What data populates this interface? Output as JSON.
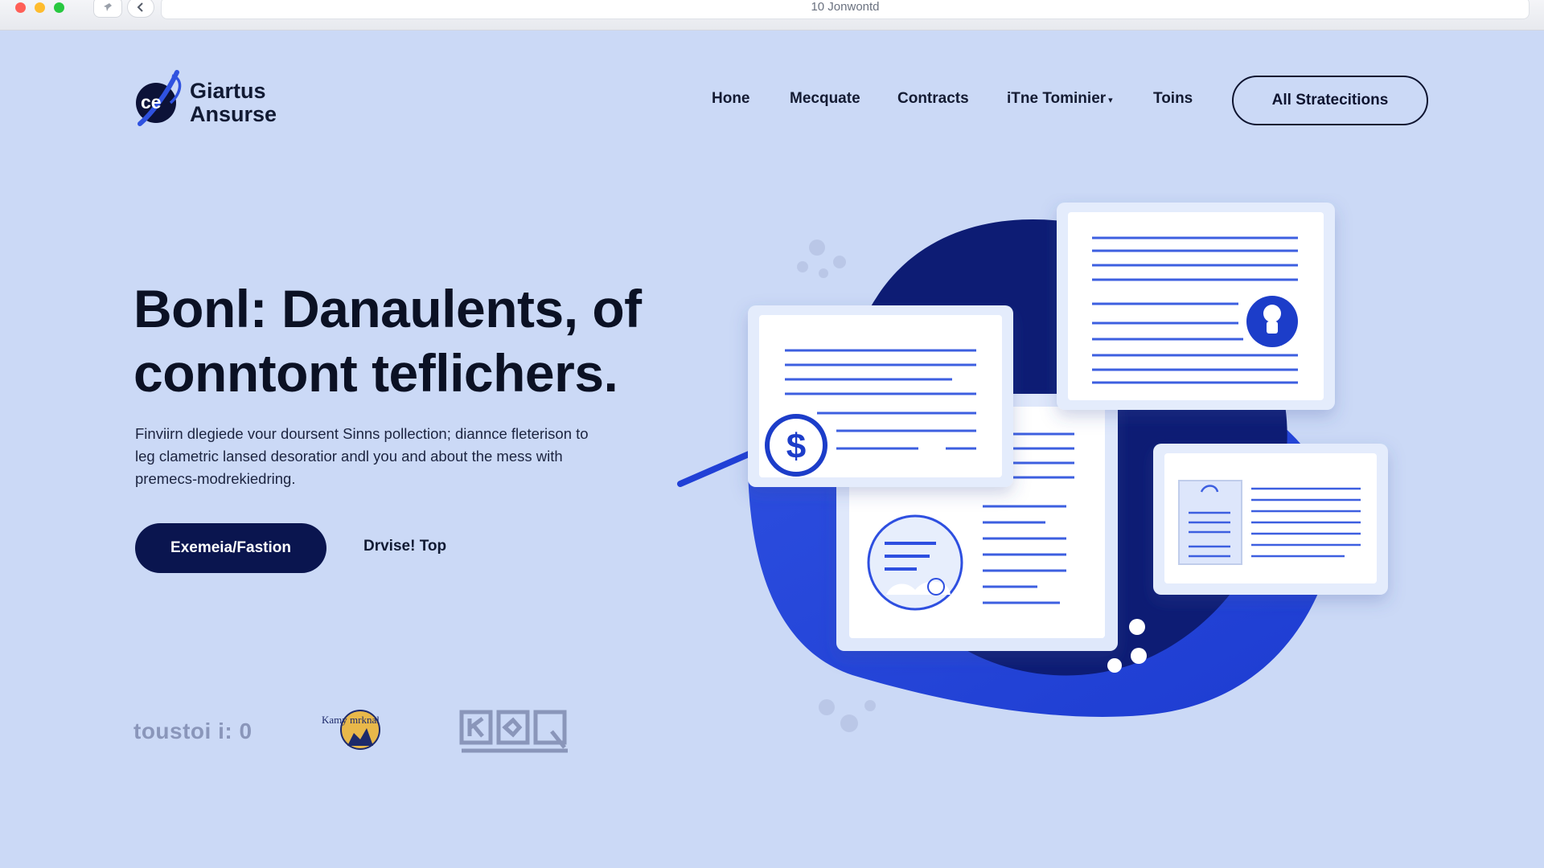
{
  "browser": {
    "address_text": "10 Jonwontd",
    "back_icon": "chevron-left-icon",
    "pin_icon": "pin-icon"
  },
  "brand": {
    "line1": "Giartus",
    "line2": "Ansurse",
    "mark_text": "ce",
    "colors": {
      "primary": "#0a154f",
      "accent": "#2343c9",
      "background": "#cbd9f6"
    }
  },
  "nav": {
    "items": [
      {
        "label": "Hone"
      },
      {
        "label": "Mecquate"
      },
      {
        "label": "Contracts"
      },
      {
        "label": "iTne Tominier",
        "has_dropdown": true
      },
      {
        "label": "Toins"
      }
    ],
    "cta_label": "All Stratecitions"
  },
  "hero": {
    "title_line1": "Bonl: Danaulents, of",
    "title_line2": "conntont teflichers.",
    "body_line1": "Finviirn dlegiede vour doursent Sinns pollection; diannce fleterison to",
    "body_line2": "leg clametric lansed desoratior andl you and about the mess with",
    "body_line3": "premecs-modrekiedring.",
    "primary_button": "Exemeia/Fastion",
    "secondary_link": "Drvise! Top"
  },
  "partners": {
    "logo1_text": "toustoi i: 0",
    "logo2_text": "Kamy mrknal",
    "logo3_icon": "kdq-logo-icon"
  },
  "illustration": {
    "currency_symbol": "$",
    "icons": [
      "dollar-coin-icon",
      "lock-icon",
      "globe-document-icon",
      "settings-gear-icon"
    ]
  }
}
